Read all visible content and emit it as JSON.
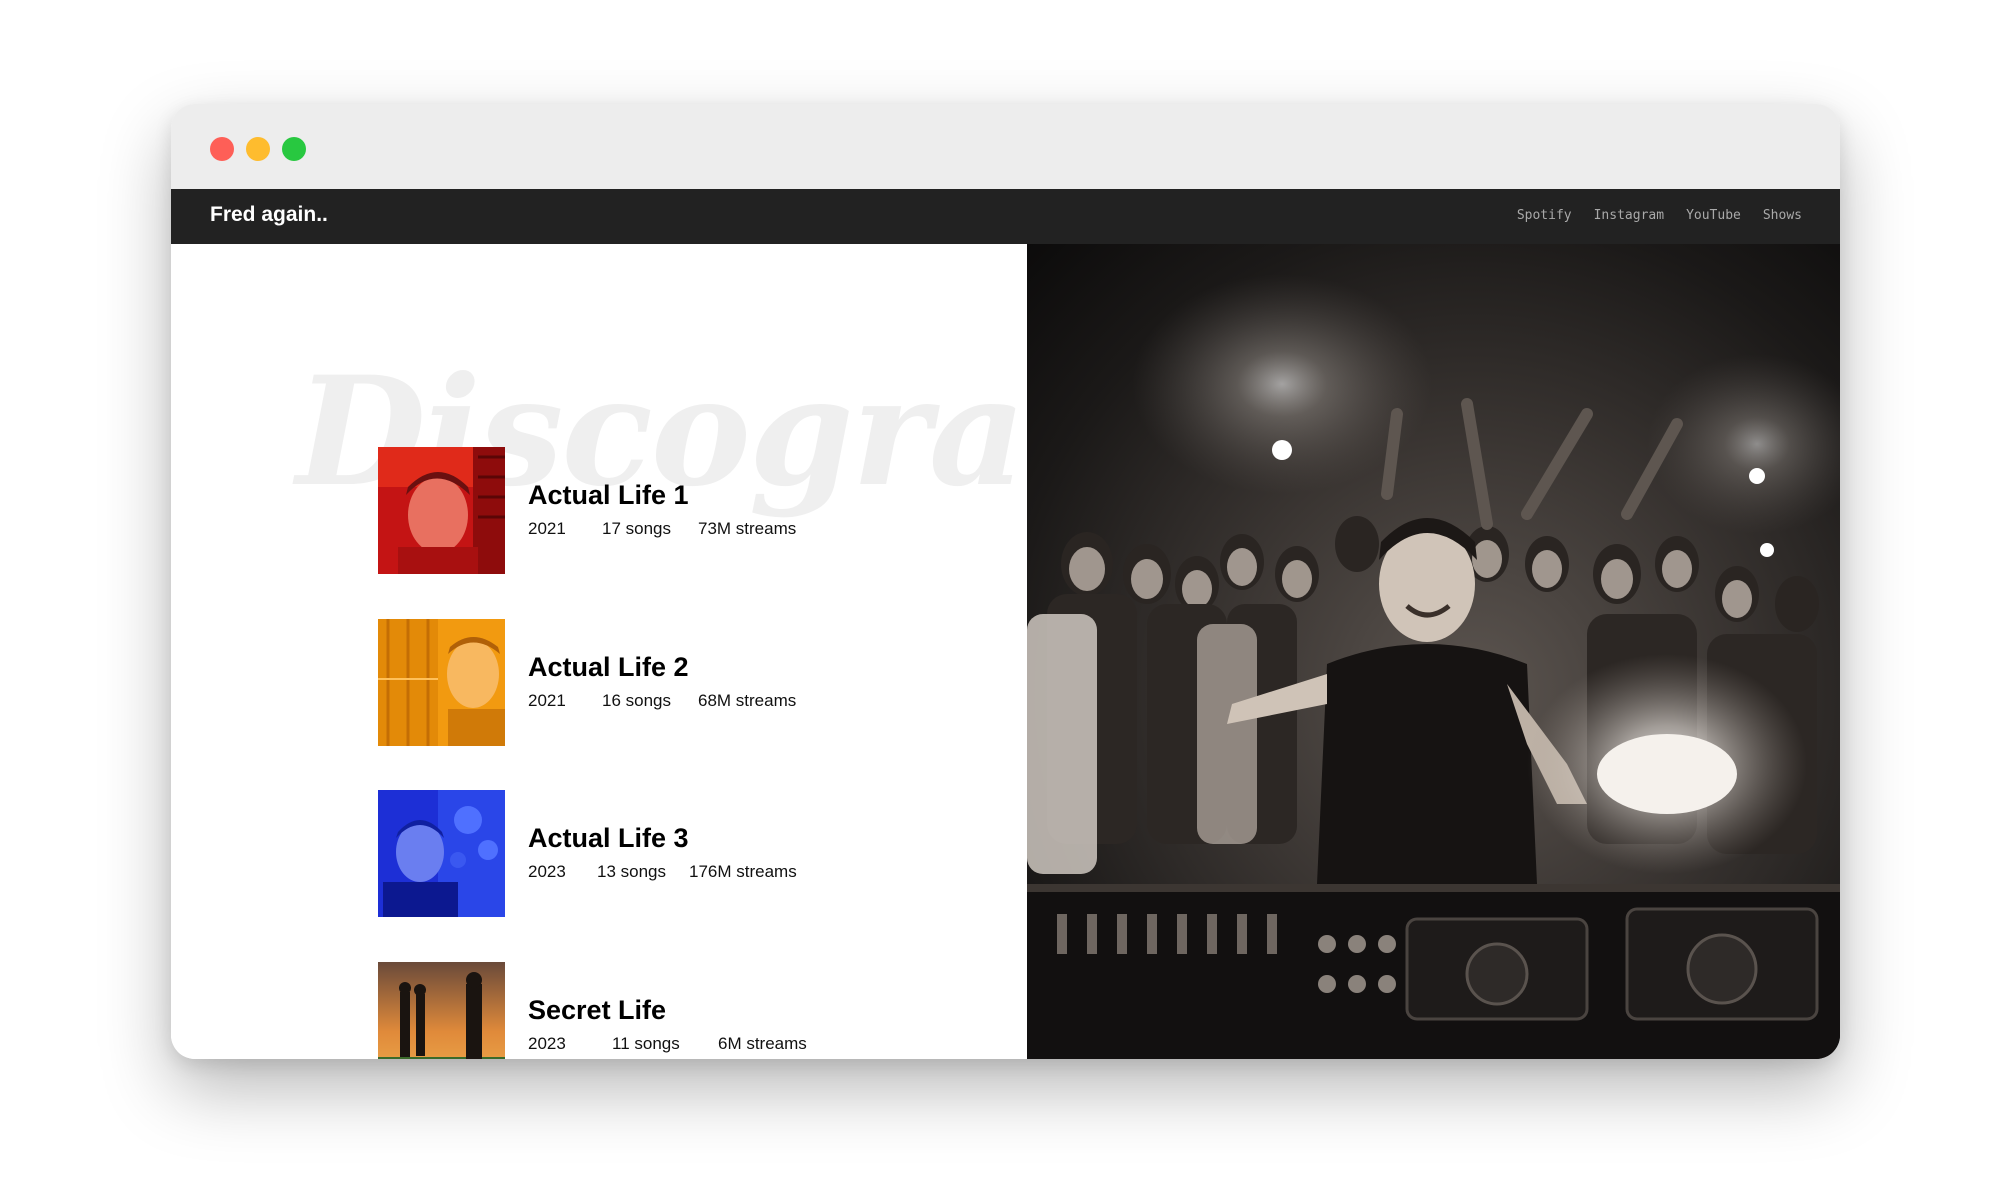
{
  "brand": "Fred again..",
  "nav": {
    "links": [
      "Spotify",
      "Instagram",
      "YouTube",
      "Shows"
    ]
  },
  "section_title": "Discography",
  "albums": [
    {
      "title": "Actual Life 1",
      "year": "2021",
      "songs": "17 songs",
      "streams": "73M streams",
      "color": "#d01818"
    },
    {
      "title": "Actual Life 2",
      "year": "2021",
      "songs": "16 songs",
      "streams": "68M streams",
      "color": "#f0960a"
    },
    {
      "title": "Actual Life 3",
      "year": "2023",
      "songs": "13 songs",
      "streams": "176M streams",
      "color": "#1f35d8"
    },
    {
      "title": "Secret Life",
      "year": "2023",
      "songs": "11 songs",
      "streams": "6M streams",
      "color": "#c86a2a"
    }
  ],
  "hero_photo": "DJ crowd photo"
}
